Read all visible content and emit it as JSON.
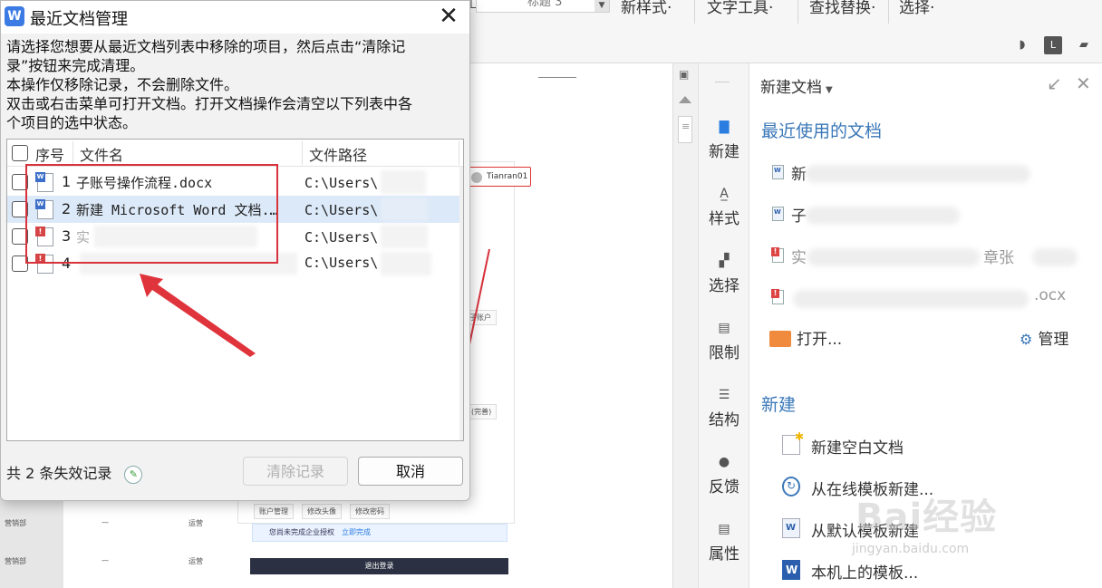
{
  "ribbon": {
    "style_box_text": "标题 3",
    "new_style": "新样式·",
    "text_tools": "文字工具·",
    "find_replace": "查找替换·",
    "select": "选择·",
    "left_partial": "☐ 2"
  },
  "doc": {
    "user_chip": "Tianran01",
    "sub_account_btn": "子账户",
    "fix_btn": "(完善)",
    "account_mgmt": "账户管理",
    "edit_avatar": "修改头像",
    "edit_password": "修改密码",
    "notice_text": "您尚未完成企业授权",
    "notice_link": "立即完成",
    "logout": "退出登录",
    "rows": [
      {
        "dept": "营销部",
        "mid": "—",
        "role": "运营"
      },
      {
        "dept": "营销部",
        "mid": "—",
        "role": "运营"
      }
    ]
  },
  "tool_strip": [
    {
      "label": "新建",
      "icon": "new-doc-icon",
      "glyph": "▇"
    },
    {
      "label": "样式",
      "icon": "style-icon",
      "glyph": "A̲"
    },
    {
      "label": "选择",
      "icon": "select-icon",
      "glyph": "▞"
    },
    {
      "label": "限制",
      "icon": "restrict-icon",
      "glyph": "▤"
    },
    {
      "label": "结构",
      "icon": "structure-icon",
      "glyph": "☰"
    },
    {
      "label": "反馈",
      "icon": "feedback-icon",
      "glyph": "●"
    },
    {
      "label": "属性",
      "icon": "properties-icon",
      "glyph": "▤"
    }
  ],
  "task_pane": {
    "title": "新建文档",
    "recent_heading": "最近使用的文档",
    "recent": [
      {
        "text": "新",
        "type": "word"
      },
      {
        "text": "子",
        "type": "word"
      },
      {
        "text": "实",
        "suffix": "章张",
        "type": "error"
      },
      {
        "text": "",
        "suffix": ".ocx",
        "type": "error"
      }
    ],
    "open_label": "打开...",
    "manage_label": "管理",
    "new_heading": "新建",
    "new_items": [
      {
        "label": "新建空白文档",
        "icon": "blank-doc-icon"
      },
      {
        "label": "从在线模板新建...",
        "icon": "online-template-icon"
      },
      {
        "label": "从默认模板新建",
        "icon": "default-template-icon"
      },
      {
        "label": "本机上的模板...",
        "icon": "local-template-icon"
      }
    ]
  },
  "watermark": {
    "main": "Bai经验",
    "url": "jingyan.baidu.com"
  },
  "dialog": {
    "title": "最近文档管理",
    "instructions": [
      "请选择您想要从最近文档列表中移除的项目，然后点击“清除记",
      "录”按钮来完成清理。",
      "本操作仅移除记录，不会删除文件。",
      "双击或右击菜单可打开文档。打开文档操作会清空以下列表中各",
      "个项目的选中状态。"
    ],
    "columns": {
      "seq": "序号",
      "name": "文件名",
      "path": "文件路径"
    },
    "rows": [
      {
        "seq": "1",
        "name": "子账号操作流程.docx",
        "path": "C:\\Users\\   方\\…",
        "type": "word",
        "selected": false
      },
      {
        "seq": "2",
        "name": "新建 Microsoft Word 文档.…",
        "path": "C:\\Users\\    方\\…",
        "type": "word",
        "selected": true
      },
      {
        "seq": "3",
        "name": "实                  净…",
        "path": "C:\\Users\\    方\\…",
        "type": "error",
        "selected": false
      },
      {
        "seq": "4",
        "name": "",
        "path": "C:\\Users\\    \\…",
        "type": "error",
        "selected": false
      }
    ],
    "footer_text": "共 2 条失效记录",
    "clear_button": "清除记录",
    "cancel_button": "取消"
  },
  "colors": {
    "accent": "#3b78b8",
    "annotation": "#d8323c",
    "selection": "#dce9f8"
  }
}
